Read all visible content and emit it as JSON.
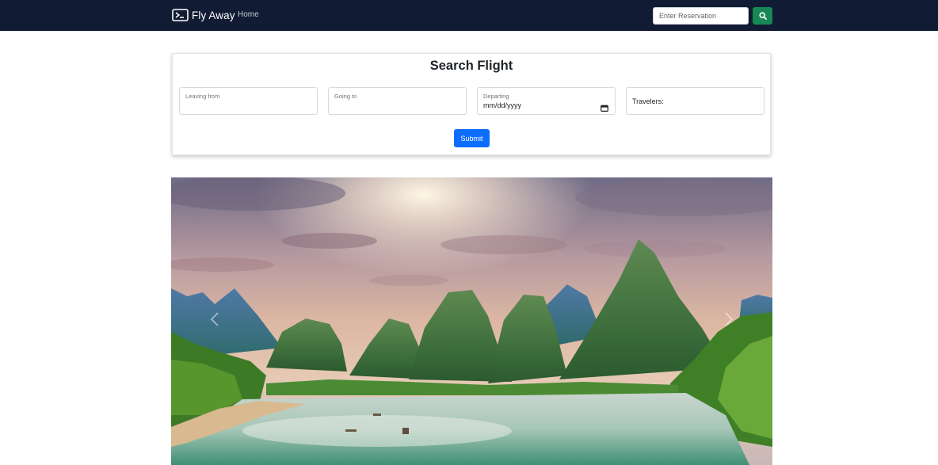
{
  "navbar": {
    "brand_icon": "airplane-ticket-icon",
    "brand": "Fly Away",
    "home_link": "Home",
    "reservation_placeholder": "Enter Reservation",
    "search_icon": "search-icon",
    "colors": {
      "background": "#111b33",
      "search_button": "#198754"
    }
  },
  "search_form": {
    "title": "Search Flight",
    "leaving_from": {
      "label": "Leaving from",
      "value": ""
    },
    "going_to": {
      "label": "Going to",
      "value": ""
    },
    "departing": {
      "label": "Departing",
      "value": "mm/dd/yyyy",
      "icon": "calendar-icon"
    },
    "travelers": {
      "label": "Travelers:"
    },
    "submit_label": "Submit",
    "colors": {
      "submit_button": "#0d6efd"
    }
  },
  "carousel": {
    "slide_image": "karst-mountains-river-landscape",
    "prev_icon": "chevron-left-icon",
    "next_icon": "chevron-right-icon"
  }
}
